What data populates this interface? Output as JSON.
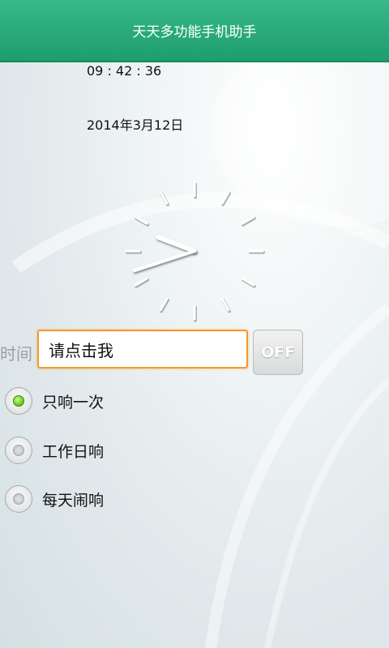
{
  "header": {
    "title": "天天多功能手机助手"
  },
  "clock": {
    "time_text": "09 : 42 : 36",
    "date_text": "2014年3月12日",
    "hour": 9,
    "minute": 42,
    "second": 36
  },
  "alarm": {
    "time_label": "时间",
    "input_placeholder": "请点击我",
    "toggle_label": "OFF"
  },
  "repeat_options": [
    {
      "label": "只响一次",
      "selected": true
    },
    {
      "label": "工作日响",
      "selected": false
    },
    {
      "label": "每天闹响",
      "selected": false
    }
  ]
}
